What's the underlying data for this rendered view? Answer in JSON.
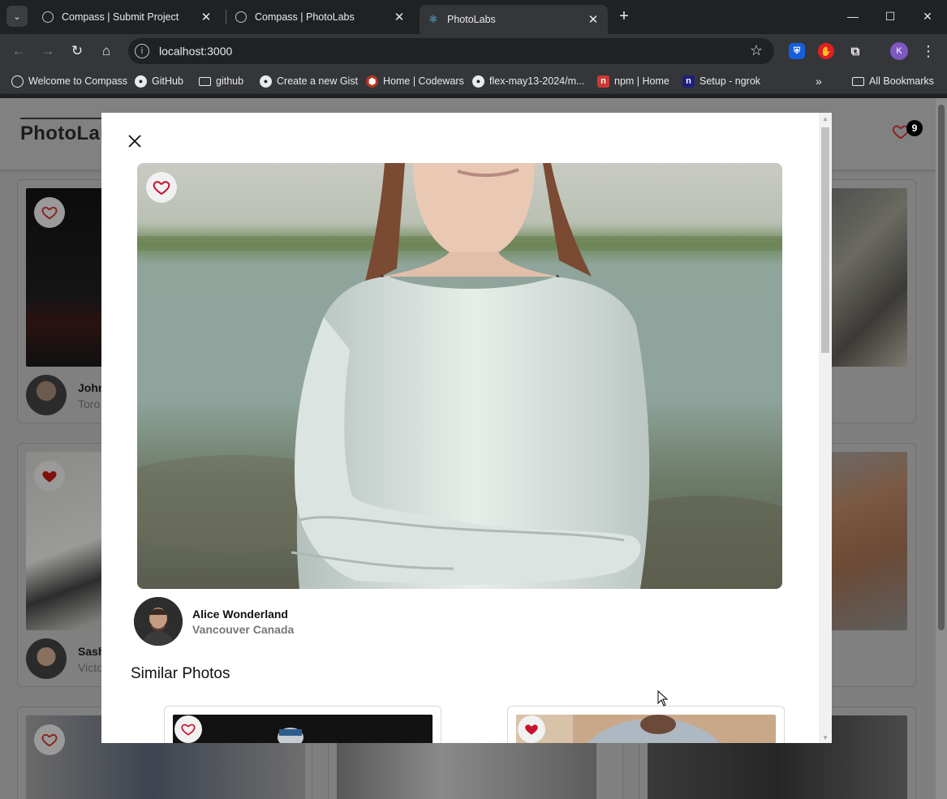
{
  "browser": {
    "tabs": [
      {
        "title": "Compass | Submit Project",
        "active": false
      },
      {
        "title": "Compass | PhotoLabs",
        "active": false
      },
      {
        "title": "PhotoLabs",
        "active": true
      }
    ],
    "url": "localhost:3000",
    "profile_initial": "K",
    "bookmarks": [
      {
        "label": "Welcome to Compass",
        "icon": "compass-icon"
      },
      {
        "label": "GitHub",
        "icon": "github-icon"
      },
      {
        "label": "github",
        "icon": "folder-icon"
      },
      {
        "label": "Create a new Gist",
        "icon": "github-icon"
      },
      {
        "label": "Home | Codewars",
        "icon": "codewars-icon"
      },
      {
        "label": "flex-may13-2024/m...",
        "icon": "github-icon"
      },
      {
        "label": "npm | Home",
        "icon": "npm-icon"
      },
      {
        "label": "Setup - ngrok",
        "icon": "ngrok-icon"
      }
    ],
    "all_bookmarks": "All Bookmarks"
  },
  "app": {
    "brand": "PhotoLabs",
    "fav_count": "9"
  },
  "background_cards": [
    {
      "name": "John",
      "location": "Toro",
      "favourited": false
    },
    {
      "name": "Sash",
      "location": "Victo",
      "favourited": true
    },
    {
      "name": "",
      "location": "",
      "favourited": false
    }
  ],
  "modal": {
    "photo_favourited": false,
    "user_name": "Alice Wonderland",
    "user_location": "Vancouver Canada",
    "similar_title": "Similar Photos",
    "similar": [
      {
        "favourited": false
      },
      {
        "favourited": true
      }
    ]
  },
  "colors": {
    "fav_red": "#c8102e",
    "overlay": "#7f7f7f",
    "modal_bg": "#ffffff"
  }
}
